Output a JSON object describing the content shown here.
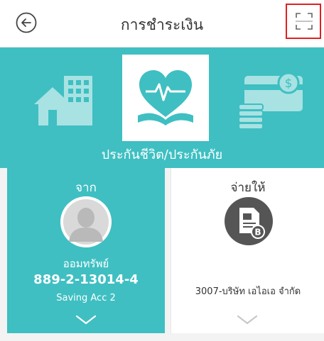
{
  "header": {
    "title": "การชำระเงิน"
  },
  "categories": {
    "selected_label": "ประกันชีวิต/ประกันภัย"
  },
  "from_panel": {
    "heading": "จาก",
    "account_type": "ออมทรัพย์",
    "account_number": "889-2-13014-4",
    "account_name": "Saving Acc 2"
  },
  "to_panel": {
    "heading": "จ่ายให้",
    "payee": "3007-บริษัท เอไอเอ จำกัด"
  },
  "colors": {
    "accent": "#3fbfc2",
    "alert_border": "#e02020",
    "icon_dark": "#555555"
  },
  "icons": {
    "back": "back-arrow-icon",
    "scan": "scan-frame-icon",
    "home": "home-building-icon",
    "insurance": "heart-book-icon",
    "bills": "cash-coins-icon",
    "avatar": "user-avatar-icon",
    "payee": "bill-document-icon",
    "expand": "chevron-down-icon"
  }
}
